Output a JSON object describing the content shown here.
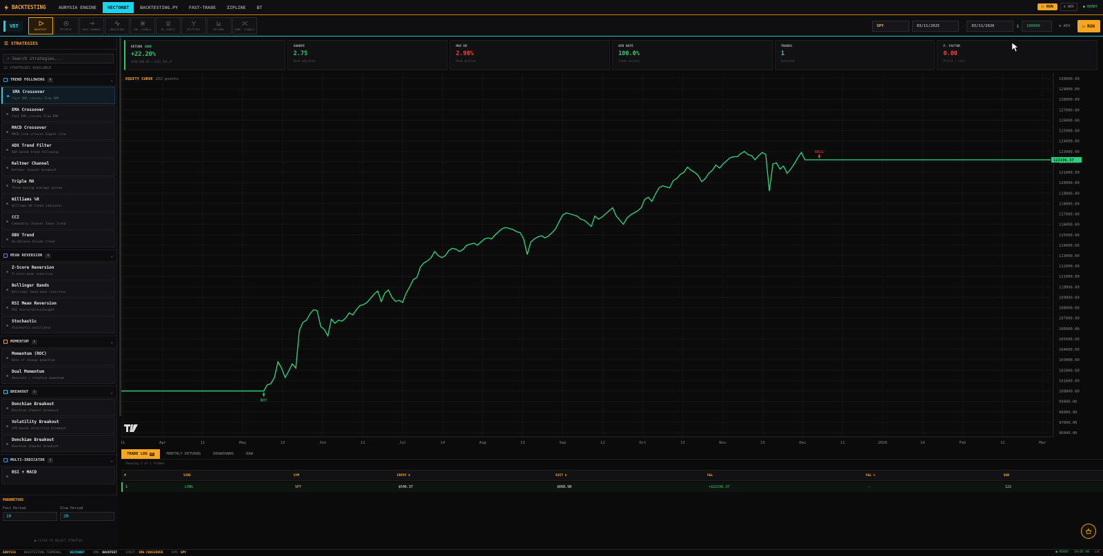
{
  "app": {
    "brand": "BACKTESTING"
  },
  "engine_tabs": [
    {
      "label": "AURYSIA ENGINE",
      "active": false
    },
    {
      "label": "VECTORBT",
      "active": true
    },
    {
      "label": "BACKTESTING.PY",
      "active": false
    },
    {
      "label": "FAST-TRADE",
      "active": false
    },
    {
      "label": "ZIPLINE",
      "active": false
    },
    {
      "label": "BT",
      "active": false
    }
  ],
  "top_right": {
    "run": "RUN",
    "adv": "ADV",
    "status": "READY"
  },
  "toolbar": {
    "badge": "VBT",
    "tools": [
      {
        "label": "BACKTEST",
        "icon": "play-icon",
        "active": true
      },
      {
        "label": "OPTIMIZE",
        "icon": "target-icon",
        "active": false
      },
      {
        "label": "WALK FORWARD",
        "icon": "arrow-right-icon",
        "active": false
      },
      {
        "label": "INDICATORS",
        "icon": "pulse-icon",
        "active": false
      },
      {
        "label": "IND. SIGNALS",
        "icon": "signal-icon",
        "active": false
      },
      {
        "label": "ML LABELS",
        "icon": "layers-icon",
        "active": false
      },
      {
        "label": "SPLITTERS",
        "icon": "split-icon",
        "active": false
      },
      {
        "label": "RETURNS",
        "icon": "bar-chart-icon",
        "active": false
      },
      {
        "label": "RAND. SIGNALS",
        "icon": "shuffle-icon",
        "active": false
      }
    ],
    "symbol": "SPY",
    "start_date": "03/11/2025",
    "date_sep": "-",
    "end_date": "03/11/2026",
    "currency": "$",
    "capital": "100000",
    "adv": "ADV",
    "run": "RUN"
  },
  "sidebar": {
    "title": "STRATEGIES",
    "search_placeholder": "Search strategies...",
    "available": "22 STRATEGIES AVAILABLE",
    "groups": [
      {
        "name": "TREND FOLLOWING",
        "count": "9",
        "color": "#18a8ff",
        "items": [
          {
            "name": "SMA Crossover",
            "desc": "Fast SMA crosses Slow SMA",
            "active": true
          },
          {
            "name": "EMA Crossover",
            "desc": "Fast EMA crosses Slow EMA"
          },
          {
            "name": "MACD Crossover",
            "desc": "MACD line crosses Signal line"
          },
          {
            "name": "ADX Trend Filter",
            "desc": "ADX-based trend following"
          },
          {
            "name": "Keltner Channel",
            "desc": "Keltner channel breakout"
          },
          {
            "name": "Triple MA",
            "desc": "Three moving average system"
          },
          {
            "name": "Williams %R",
            "desc": "Williams %R trend indicator"
          },
          {
            "name": "CCI",
            "desc": "Commodity Channel Index trend"
          },
          {
            "name": "OBV Trend",
            "desc": "On-Balance Volume trend"
          }
        ]
      },
      {
        "name": "MEAN REVERSION",
        "count": "4",
        "color": "#a066ff",
        "items": [
          {
            "name": "Z-Score Reversion",
            "desc": "Z-score mean reversion"
          },
          {
            "name": "Bollinger Bands",
            "desc": "Bollinger band mean reversion"
          },
          {
            "name": "RSI Mean Reversion",
            "desc": "RSI oversold/overbought"
          },
          {
            "name": "Stochastic",
            "desc": "Stochastic oscillator"
          }
        ]
      },
      {
        "name": "MOMENTUM",
        "count": "2",
        "color": "#f5a623",
        "items": [
          {
            "name": "Momentum (ROC)",
            "desc": "Rate of change momentum"
          },
          {
            "name": "Dual Momentum",
            "desc": "Absolute + relative momentum"
          }
        ]
      },
      {
        "name": "BREAKOUT",
        "count": "3",
        "color": "#18d6f0",
        "items": [
          {
            "name": "Donchian Breakout",
            "desc": "Donchian channel breakout"
          },
          {
            "name": "Volatility Breakout",
            "desc": "ATR-based volatility breakout"
          },
          {
            "name": "Donchian Breakout",
            "desc": "Donchian channel breakout"
          }
        ]
      },
      {
        "name": "MULTI-INDICATOR",
        "count": "3",
        "color": "#18a8ff",
        "items": [
          {
            "name": "RSI + MACD",
            "desc": ""
          }
        ]
      }
    ]
  },
  "params": {
    "title": "PARAMETERS",
    "fast_label": "Fast Period",
    "fast_value": "10",
    "slow_label": "Slow Period",
    "slow_value": "20",
    "hint": "CLICK TO SELECT STRATEGY"
  },
  "metrics": [
    {
      "label": "RETURN",
      "badge": "DONE",
      "value": "+22.20%",
      "sub": "$100,000.00 → $122,196.37",
      "color": "green"
    },
    {
      "label": "SHARPE",
      "value": "2.75",
      "sub": "Risk-adjusted",
      "color": "green"
    },
    {
      "label": "MAX DD",
      "value": "2.98%",
      "sub": "Peak decline",
      "color": "red"
    },
    {
      "label": "WIN RATE",
      "value": "100.0%",
      "sub": "Trade success",
      "color": "green"
    },
    {
      "label": "TRADES",
      "value": "1",
      "sub": "Executed",
      "color": "cyan"
    },
    {
      "label": "P. FACTOR",
      "value": "0.00",
      "sub": "Profit / Loss",
      "color": "red"
    }
  ],
  "chart_data": {
    "type": "line",
    "title": "EQUITY CURVE",
    "points_label": "252 points",
    "ylim": [
      96000,
      130000
    ],
    "y_ticks": [
      "130000.00",
      "129000.00",
      "128000.00",
      "127000.00",
      "126000.00",
      "125000.00",
      "124000.00",
      "123000.00",
      "122000.00",
      "121000.00",
      "120000.00",
      "119000.00",
      "118000.00",
      "117000.00",
      "116000.00",
      "115000.00",
      "114000.00",
      "113000.00",
      "112000.00",
      "111000.00",
      "110000.00",
      "109000.00",
      "108000.00",
      "107000.00",
      "106000.00",
      "105000.00",
      "104000.00",
      "103000.00",
      "102000.00",
      "101000.00",
      "100000.00",
      "99000.00",
      "98000.00",
      "97000.00",
      "96000.00"
    ],
    "x_ticks": [
      "11",
      "Apr",
      "11",
      "May",
      "13",
      "Jun",
      "12",
      "Jul",
      "14",
      "Aug",
      "13",
      "Sep",
      "12",
      "Oct",
      "13",
      "Nov",
      "13",
      "Dec",
      "11",
      "2026",
      "14",
      "Feb",
      "12",
      "Mar"
    ],
    "last_value": "122196.37",
    "series": [
      {
        "values": [
          100000,
          100000,
          100000,
          100000,
          100000,
          100000,
          100000,
          100000,
          100000,
          100000,
          100000,
          100000,
          100000,
          100000,
          100000,
          100000,
          100000,
          100000,
          100000,
          100000,
          100000,
          100000,
          100000,
          100000,
          100000,
          100000,
          100000,
          100000,
          100000,
          100000,
          100000,
          100000,
          100000,
          100000,
          100000,
          100000,
          100000,
          100000,
          100000,
          100000,
          100000,
          100600,
          100700,
          101300,
          102800,
          102200,
          101300,
          101900,
          102600,
          102200,
          105800,
          106600,
          106800,
          107400,
          107800,
          107700,
          106200,
          105900,
          105300,
          106900,
          106500,
          106800,
          106700,
          107000,
          107500,
          107300,
          107800,
          108200,
          108300,
          108500,
          108900,
          109300,
          109600,
          108600,
          109400,
          109700,
          109000,
          108600,
          108700,
          108500,
          109400,
          110000,
          110700,
          110900,
          111900,
          112300,
          112500,
          112800,
          113400,
          113000,
          112800,
          113000,
          113500,
          113700,
          113600,
          113400,
          113600,
          114000,
          114100,
          114200,
          114000,
          114300,
          114600,
          114700,
          114600,
          115000,
          115300,
          115600,
          115700,
          115600,
          115500,
          115300,
          115200,
          114600,
          113100,
          114300,
          114600,
          114800,
          114900,
          114700,
          114900,
          115200,
          115600,
          116300,
          116900,
          117100,
          117000,
          116900,
          116800,
          116500,
          116400,
          116100,
          115800,
          116800,
          116500,
          116700,
          117000,
          117300,
          117600,
          116800,
          116400,
          116000,
          116600,
          116900,
          117100,
          117300,
          117600,
          118400,
          118600,
          118200,
          118900,
          119500,
          119700,
          119600,
          119500,
          120200,
          120400,
          120800,
          121000,
          121500,
          121200,
          121000,
          120700,
          120100,
          120400,
          120900,
          121200,
          121700,
          121400,
          121800,
          122100,
          122400,
          122500,
          122500,
          122800,
          123000,
          122700,
          122600,
          122200,
          122600,
          122900,
          122700,
          119200,
          121800,
          121900,
          121300,
          121600,
          120900,
          121300,
          121800,
          122400,
          122900,
          122200,
          122200,
          122200,
          122200,
          122200,
          122200,
          122200,
          122200,
          122200,
          122200,
          122200,
          122200,
          122200,
          122200,
          122200,
          122200,
          122200,
          122200,
          122200,
          122200,
          122200,
          122200,
          122200,
          122200,
          122200,
          122200,
          122200,
          122200,
          122200,
          122200,
          122200,
          122200,
          122200,
          122200,
          122200,
          122200,
          122200,
          122200,
          122200,
          122200,
          122200,
          122200,
          122200,
          122200,
          122200,
          122200,
          122200,
          122200,
          122200,
          122200,
          122200,
          122200,
          122200,
          122200,
          122200,
          122200,
          122200,
          122200,
          122200,
          122200,
          122200,
          122200,
          122200,
          122200,
          122200,
          122200,
          122200,
          122200,
          122200,
          122196.37
        ]
      }
    ],
    "markers": [
      {
        "label": "BUY",
        "index": 40,
        "value": 100000,
        "kind": "buy"
      },
      {
        "label": "SELL",
        "index": 196,
        "value": 122200,
        "kind": "sell"
      }
    ]
  },
  "bottom_tabs": [
    {
      "label": "TRADE LOG",
      "count": "1",
      "active": true
    },
    {
      "label": "MONTHLY RETURNS"
    },
    {
      "label": "DRAWDOWNS"
    },
    {
      "label": "RAW"
    }
  ],
  "trades": {
    "showing": "Showing 1 of 1 trades",
    "columns": [
      "#",
      "SIDE",
      "SYM",
      "ENTRY $",
      "EXIT $",
      "P&L",
      "P&L %",
      "DUR"
    ],
    "rows": [
      [
        "1",
        "LONG",
        "SPY",
        "$546.37",
        "$668.98",
        "+$22196.37",
        "--",
        "122"
      ]
    ]
  },
  "statusbar": {
    "brand": "AURYSIA",
    "terminal": "BACKTESTING TERMINAL",
    "engine": "VECTORBT",
    "cmd_label": "CMD:",
    "cmd": "BACKTEST",
    "strat_label": "STRAT:",
    "strat": "SMA CROSSOVER",
    "sym_label": "SYM:",
    "sym": "SPY",
    "status": "READY",
    "time": "19:05:48",
    "loc": "LOC"
  }
}
